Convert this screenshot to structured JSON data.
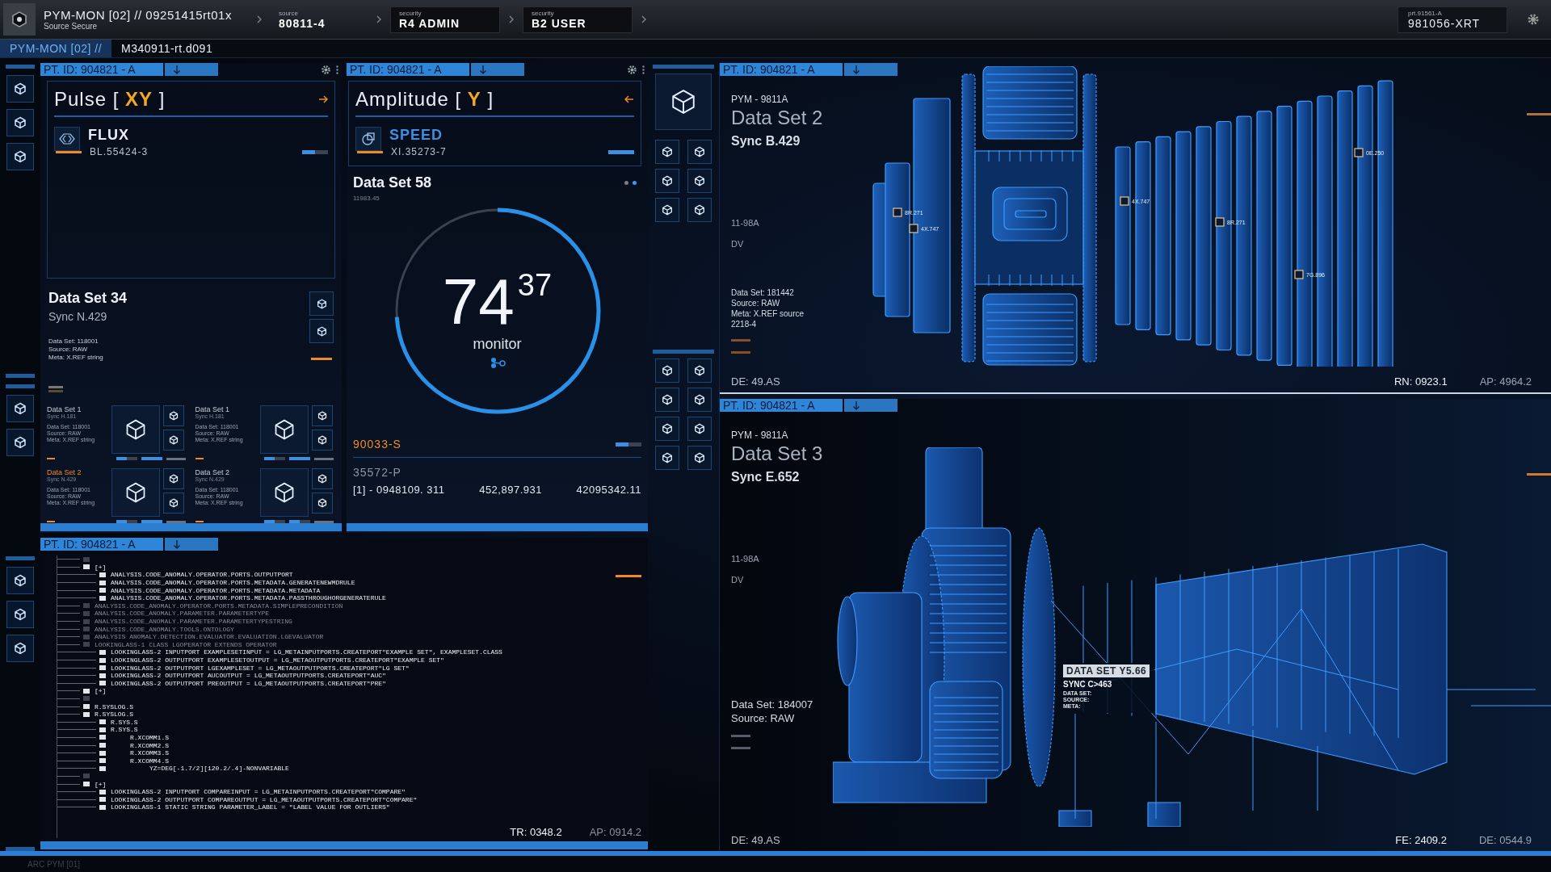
{
  "top_bar": {
    "title": "PYM-MON [02] // 09251415rt01x",
    "subtitle": "Source Secure",
    "crumbs": [
      {
        "caption": "source",
        "value": "80811-4",
        "kind": "plain"
      },
      {
        "caption": "security",
        "value": "R4 ADMIN",
        "kind": "boxed"
      },
      {
        "caption": "security",
        "value": "B2 USER",
        "kind": "boxed"
      }
    ],
    "right_caption": "prt.91561-A",
    "right_value": "981056-XRT"
  },
  "tabs": [
    {
      "label": "PYM-MON [02] //",
      "selected": true
    },
    {
      "label": "M340911-rt.d091",
      "selected": false
    }
  ],
  "pulse_panel": {
    "header": "PT. ID: 904821 - A",
    "title": "Pulse",
    "bracket_open": "[",
    "tag": "XY",
    "bracket_close": "]",
    "channel": {
      "name": "FLUX",
      "code": "BL.55424-3",
      "active": false,
      "level": 0.5
    },
    "dataset": {
      "title": "Data Set 34",
      "sync": "Sync N.429",
      "meta": [
        "Data Set: 118001",
        "Source: RAW",
        "Meta: X.REF string"
      ]
    },
    "cards": [
      {
        "title": "Data Set 1",
        "sync": "Sync H.181",
        "meta": [
          "Data Set: 118001",
          "Source: RAW",
          "Meta: X.REF string"
        ],
        "alert": false,
        "meters": [
          {
            "level": 0.5
          },
          {
            "level": 1
          }
        ]
      },
      {
        "title": "Data Set 1",
        "sync": "Sync H.181",
        "meta": [
          "Data Set: 118001",
          "Source: RAW",
          "Meta: X.REF string"
        ],
        "alert": false,
        "meters": [
          {
            "level": 0.5
          },
          {
            "level": 1
          }
        ]
      },
      {
        "title": "Data Set 2",
        "sync": "Sync N.429",
        "meta": [
          "Data Set: 118001",
          "Source: RAW",
          "Meta: X.REF string"
        ],
        "alert": true,
        "meters": [
          {
            "level": 0.5
          },
          {
            "level": 1
          }
        ]
      },
      {
        "title": "Data Set 2",
        "sync": "Sync N.429",
        "meta": [
          "Data Set: 118001",
          "Source: RAW",
          "Meta: X.REF string"
        ],
        "alert": false,
        "meters": [
          {
            "level": 0.5
          },
          {
            "level": 0.5
          }
        ]
      }
    ]
  },
  "amplitude_panel": {
    "header": "PT. ID: 904821 - A",
    "title": "Amplitude",
    "bracket_open": "[",
    "tag": "Y",
    "bracket_close": "]",
    "channel": {
      "name": "SPEED",
      "code": "XI.35273-7",
      "active": true,
      "level": 1
    },
    "dataset": {
      "title": "Data Set 58",
      "value": "11983.45"
    },
    "pager": [
      {
        "selected": false
      },
      {
        "selected": true
      }
    ],
    "gauge": {
      "level": 0.74,
      "whole": "74",
      "fraction": "37",
      "label": "monitor"
    },
    "alert_code": "90033-S",
    "alert_meter": {
      "level": 0.5
    },
    "code": "35572-P",
    "readings": [
      "[1] - 0948109. 311",
      "452,897.931",
      "42095342.11"
    ]
  },
  "code_panel": {
    "header": "PT. ID: 904821 - A",
    "tree": [
      {
        "dim": true
      },
      {
        "label": "[+]",
        "dim": false,
        "children": [
          {
            "label": "ANALYSIS.CODE_ANOMALY.OPERATOR.PORTS.OUTPUTPORT",
            "dim": false
          },
          {
            "label": "ANALYSIS.CODE_ANOMALY.OPERATOR.PORTS.METADATA.GENERATENEWMDRULE",
            "dim": false
          },
          {
            "label": "ANALYSIS.CODE_ANOMALY.OPERATOR.PORTS.METADATA.METADATA",
            "dim": false
          },
          {
            "label": "ANALYSIS.CODE_ANOMALY.OPERATOR.PORTS.METADATA.PASSTHROUGHORGENERATERULE",
            "dim": false
          }
        ]
      },
      {
        "label": "ANALYSIS.CODE_ANOMALY.OPERATOR.PORTS.METADATA.SIMPLEPRECONDITION",
        "dim": true
      },
      {
        "label": "ANALYSIS.CODE_ANOMALY.PARAMETER.PARAMETERTYPE",
        "dim": true
      },
      {
        "label": "ANALYSIS.CODE_ANOMALY.PARAMETER.PARAMETERTYPESTRING",
        "dim": true
      },
      {
        "label": "ANALYSIS.CODE_ANOMALY.TOOLS.ONTOLOGY",
        "dim": true
      },
      {
        "label": "ANALYSIS ANOMALY.DETECTION.EVALUATOR.EVALUATION.LGEVALUATOR",
        "dim": true
      },
      {
        "label": "LOOKINGLASS-1 CLASS LGOPERATOR EXTENDS OPERATOR",
        "dim": true,
        "children": [
          {
            "label": "LOOKINGLASS-2 INPUTPORT EXAMPLESETINPUT = LG_METAINPUTPORTS.CREATEPORT\"EXAMPLE SET\", EXAMPLESET.CLASS",
            "dim": false
          },
          {
            "label": "LOOKINGLASS-2 OUTPUTPORT EXAMPLESETOUTPUT = LG_METAOUTPUTPORTS.CREATEPORT\"EXAMPLE SET\"",
            "dim": false
          },
          {
            "label": "LOOKINGLASS-2 OUTPUTPORT LGEXAMPLESET = LG_METAOUTPUTPORTS.CREATEPORT\"LG SET\"",
            "dim": false
          },
          {
            "label": "LOOKINGLASS-2 OUTPUTPORT AUCOUTPUT = LG_METAOUTPUTPORTS.CREATEPORT\"AUC\"",
            "dim": false
          },
          {
            "label": "LOOKINGLASS-2 OUTPUTPORT PREOUTPUT = LG_METAOUTPUTPORTS.CREATEPORT\"PRE\"",
            "dim": false
          }
        ]
      },
      {
        "label": "[+]",
        "dim": false
      },
      {
        "dim": true
      },
      {
        "label": "R.SYSLOG.S",
        "dim": false
      },
      {
        "label": "R.SYSLOG.S",
        "dim": false,
        "children": [
          {
            "label": "R.SYS.S",
            "dim": false
          },
          {
            "label": "R.SYS.S",
            "dim": false,
            "children": [
              {
                "label": "R.XCOMM1.S",
                "dim": false
              },
              {
                "label": "R.XCOMM2.S",
                "dim": false
              },
              {
                "label": "R.XCOMM3.S",
                "dim": false
              },
              {
                "label": "R.XCOMM4.S",
                "dim": false,
                "children": [
                  {
                    "label": "YZ=DEG[-1.7/2][120.2/.4]-NONVARIABLE",
                    "dim": false
                  }
                ]
              }
            ]
          }
        ]
      },
      {
        "dim": true
      },
      {
        "label": "[+]",
        "dim": false,
        "children": [
          {
            "label": "LOOKINGLASS-2 INPUTPORT COMPAREINPUT = LG_METAINPUTPORTS.CREATEPORT\"COMPARE\"",
            "dim": false
          },
          {
            "label": "LOOKINGLASS-2 OUTPUTPORT COMPAREOUTPUT = LG_METAOUTPUTPORTS.CREATEPORT\"COMPARE\"",
            "dim": false
          },
          {
            "label": "LOOKINGLASS-1 STATIC STRING PARAMETER_LABEL = \"LABEL VALUE FOR OUTLIERS\"",
            "dim": false
          }
        ]
      }
    ],
    "readings": [
      "TR: 0348.2",
      "AP: 0914.2"
    ]
  },
  "model_top": {
    "header": "PT. ID: 904821 - A",
    "model": "PYM - 9811A",
    "title": "Data Set 2",
    "sync": "Sync B.429",
    "codes": [
      "11-98A",
      "DV"
    ],
    "meta": [
      "Data Set: 181442",
      "Source: RAW",
      "Meta: X.REF source",
      "2218-4"
    ],
    "markers": [
      "8R.271",
      "4X.747",
      "4X.747",
      "8R.271",
      "0E.250",
      "7G.896"
    ],
    "footer_left": "DE: 49.AS",
    "footer_right": [
      "RN: 0923.1",
      "AP: 4964.2"
    ]
  },
  "model_bottom": {
    "header": "PT. ID: 904821 - A",
    "model": "PYM - 9811A",
    "title": "Data Set 3",
    "sync": "Sync E.652",
    "codes": [
      "11-98A",
      "DV"
    ],
    "meta": [
      "Data Set: 184007",
      "Source: RAW"
    ],
    "callout": {
      "title": "DATA SET Y5.66",
      "subtitle": "SYNC C>463",
      "fields": [
        "DATA SET:",
        "SOURCE:",
        "META:"
      ]
    },
    "footer_left": "DE: 49.AS",
    "footer_right": [
      "FE: 2409.2",
      "DE: 0544.9"
    ]
  },
  "status_bar": {
    "label": "ARC PYM [01]"
  }
}
